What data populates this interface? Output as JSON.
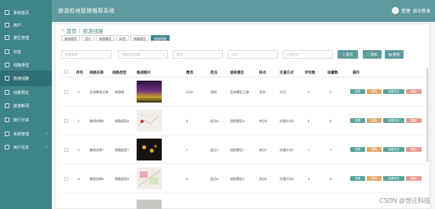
{
  "app": {
    "title": "旅游胜地管理推荐系统"
  },
  "user": {
    "label": "管理",
    "logout": "退出登录"
  },
  "sidebar": {
    "items": [
      {
        "label": "系统首页"
      },
      {
        "label": "用户"
      },
      {
        "label": "景区管理"
      },
      {
        "label": "标签"
      },
      {
        "label": "线路类型"
      },
      {
        "label": "旅游线路"
      },
      {
        "label": "线路预定"
      },
      {
        "label": "旅游新闻"
      },
      {
        "label": "旅行分享"
      },
      {
        "label": "系统管理"
      },
      {
        "label": "用户信息"
      }
    ]
  },
  "breadcrumb": {
    "home": "首页",
    "current": "旅游线路"
  },
  "tags": [
    "旅游首页",
    "用户",
    "旅游景区",
    "标签",
    "线路类型",
    "旅游线路"
  ],
  "search": {
    "placeholders": [
      "线路名称",
      "线路类型搜索",
      "起点",
      "终点",
      "交通方式"
    ],
    "search_btn": "查询",
    "add_btn": "添加",
    "delete_btn": "删除"
  },
  "table": {
    "headers": [
      "序号",
      "线路名称",
      "线路类型",
      "路线图片",
      "费用",
      "起点",
      "途经景区",
      "终点",
      "交通方式",
      "评论数",
      "收藏数",
      "操作"
    ],
    "rows": [
      {
        "index": "1",
        "name": "亚洲景观之旅",
        "type": "旅游线",
        "img": "night-river",
        "cost": "2000",
        "start": "深圳",
        "via": "亚洲景区之旅",
        "end": "北京",
        "transport": "大巴",
        "comments": "0",
        "favorites": "0"
      },
      {
        "index": "2",
        "name": "路线名称8",
        "type": "线路类型8",
        "img": "map",
        "cost": "8",
        "start": "起点8",
        "via": "途经景区8",
        "end": "终点8",
        "transport": "交通方式8",
        "comments": "8",
        "favorites": "8"
      },
      {
        "index": "3",
        "name": "路线名称7",
        "type": "线路类型7",
        "img": "dark-lights",
        "cost": "7",
        "start": "起点7",
        "via": "途经景区7",
        "end": "终点7",
        "transport": "交通方式7",
        "comments": "7",
        "favorites": "7"
      },
      {
        "index": "4",
        "name": "路线名称6",
        "type": "线路类型6",
        "img": "map-pink",
        "cost": "6",
        "start": "起点6",
        "via": "途经景区6",
        "end": "终点6",
        "transport": "交通方式6",
        "comments": "6",
        "favorites": "6"
      }
    ],
    "actions": [
      "查看",
      "修改",
      "查看评论",
      "删除"
    ]
  },
  "watermark": "CSDN @世迁科技"
}
